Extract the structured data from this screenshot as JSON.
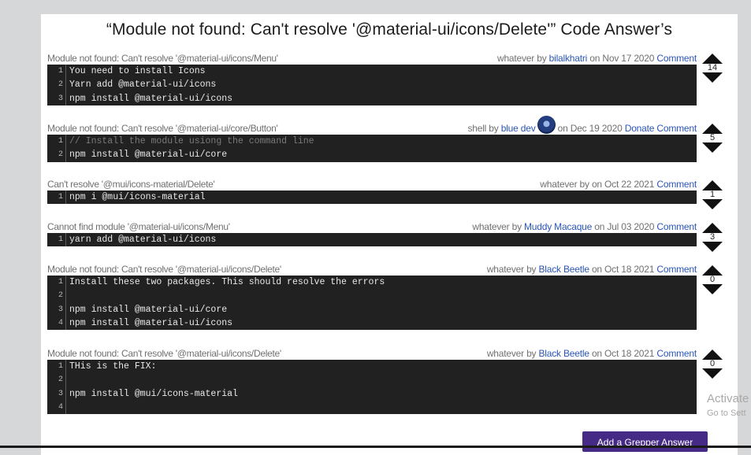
{
  "title": "“Module not found: Can't resolve '@material-ui/icons/Delete'” Code Answer’s",
  "answers": [
    {
      "question": "Module not found: Can't resolve '@material-ui/icons/Menu'",
      "lang": "whatever",
      "by": "by",
      "author": "bilalkhatri",
      "on": "on",
      "date": "Nov 17 2020",
      "donate": "",
      "comment": "Comment",
      "votes": "14",
      "lines": [
        {
          "n": "1",
          "t": "You need to install Icons"
        },
        {
          "n": "2",
          "t": "Yarn add @material-ui/icons"
        },
        {
          "n": "3",
          "t": "npm install @material-ui/icons"
        }
      ]
    },
    {
      "question": "Module not found: Can't resolve '@material-ui/core/Button'",
      "lang": "shell",
      "by": "by",
      "author": "blue dev",
      "on": "on",
      "date": "Dec 19 2020",
      "donate": "Donate",
      "comment": "Comment",
      "votes": "5",
      "lines": [
        {
          "n": "1",
          "t": "// Install the module usiong the command line"
        },
        {
          "n": "2",
          "t": "npm install @material-ui/core"
        }
      ]
    },
    {
      "question": "Can't resolve '@mui/icons-material/Delete'",
      "lang": "whatever",
      "by": "by",
      "author": "",
      "on": "on",
      "date": "Oct 22 2021",
      "donate": "",
      "comment": "Comment",
      "votes": "1",
      "lines": [
        {
          "n": "1",
          "t": "npm i @mui/icons-material"
        }
      ]
    },
    {
      "question": "Cannot find module '@material-ui/icons/Menu'",
      "lang": "whatever",
      "by": "by",
      "author": "Muddy Macaque",
      "on": "on",
      "date": "Jul 03 2020",
      "donate": "",
      "comment": "Comment",
      "votes": "3",
      "lines": [
        {
          "n": "1",
          "t": "yarn add @material-ui/icons"
        }
      ]
    },
    {
      "question": "Module not found: Can't resolve '@material-ui/icons/Delete'",
      "lang": "whatever",
      "by": "by",
      "author": "Black Beetle",
      "on": "on",
      "date": "Oct 18 2021",
      "donate": "",
      "comment": "Comment",
      "votes": "0",
      "lines": [
        {
          "n": "1",
          "t": "Install these two packages. This should resolve the errors"
        },
        {
          "n": "2",
          "t": ""
        },
        {
          "n": "3",
          "t": "npm install @material-ui/core"
        },
        {
          "n": "4",
          "t": "npm install @material-ui/icons"
        }
      ]
    },
    {
      "question": "Module not found: Can't resolve '@material-ui/icons/Delete'",
      "lang": "whatever",
      "by": "by",
      "author": "Black Beetle",
      "on": "on",
      "date": "Oct 18 2021",
      "donate": "",
      "comment": "Comment",
      "votes": "0",
      "lines": [
        {
          "n": "1",
          "t": "THis is the FIX:"
        },
        {
          "n": "2",
          "t": ""
        },
        {
          "n": "3",
          "t": "npm install @mui/icons-material"
        },
        {
          "n": "4",
          "t": ""
        }
      ]
    }
  ],
  "add_button": "Add a Grepper Answer",
  "watermark": {
    "line1": "Activate",
    "line2": "Go to Sett"
  }
}
